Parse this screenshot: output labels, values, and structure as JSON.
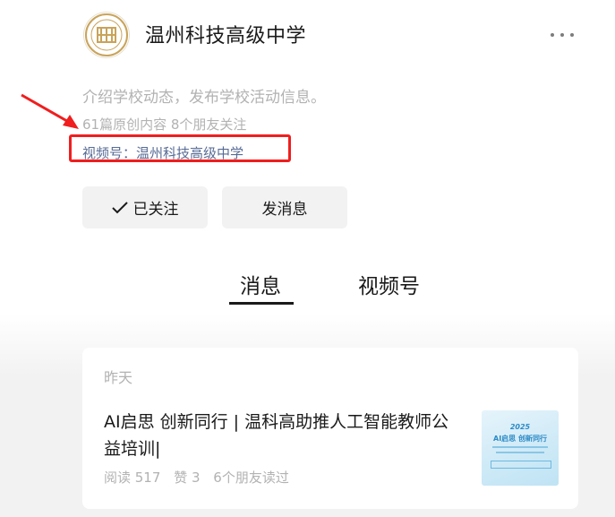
{
  "account": {
    "name": "温州科技高级中学",
    "intro": "介绍学校动态，发布学校活动信息。",
    "stats": "61篇原创内容  8个朋友关注",
    "channel": "视频号：温州科技高级中学"
  },
  "actions": {
    "followed_label": "已关注",
    "message_label": "发消息"
  },
  "tabs": [
    {
      "label": "消息",
      "active": true
    },
    {
      "label": "视频号",
      "active": false
    }
  ],
  "feed": {
    "date": "昨天",
    "article": {
      "title": "AI启思 创新同行 | 温科高助推人工智能教师公益培训|",
      "reads": "阅读 517",
      "likes": "赞 3",
      "friends_read": "6个朋友读过",
      "thumbnail": {
        "year": "2025",
        "title": "AI启思 创新同行"
      }
    }
  },
  "colors": {
    "highlight": "#f01e1e",
    "link": "#576b95",
    "muted": "#b2b2b2",
    "button_bg": "#f2f2f2"
  },
  "icons": {
    "more": "more-horizontal-icon",
    "check": "check-icon",
    "logo": "school-logo-icon"
  }
}
